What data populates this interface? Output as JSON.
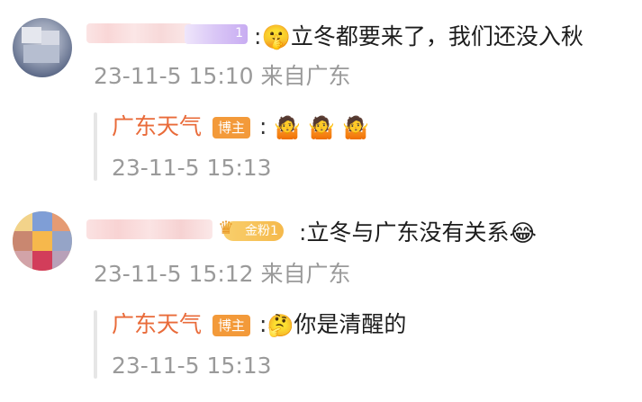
{
  "comments": [
    {
      "text_colon": ":",
      "emoji_main": "🤫",
      "text": "立冬都要来了，我们还没入秋",
      "meta": "23-11-5 15:10 来自广东",
      "badge_text": "1",
      "reply": {
        "author": "广东天气",
        "badge": "博主",
        "colon": ":",
        "emojis": [
          "🤷",
          "🤷",
          "🤷"
        ],
        "meta": "23-11-5 15:13"
      }
    },
    {
      "text_colon": ":",
      "text": "立冬与广东没有关系",
      "emoji_main": "😂",
      "meta": "23-11-5 15:12 来自广东",
      "badge_text": "金粉1",
      "reply": {
        "author": "广东天气",
        "badge": "博主",
        "colon": ":",
        "emoji": "🤔",
        "text": "你是清醒的",
        "meta": "23-11-5 15:13"
      }
    }
  ],
  "icons": {
    "fan_crown_icon": "crown-icon",
    "colors": {
      "reply_author": "#e96b3a",
      "host_badge": "#f39a3a",
      "meta": "#9a9a9a"
    }
  }
}
